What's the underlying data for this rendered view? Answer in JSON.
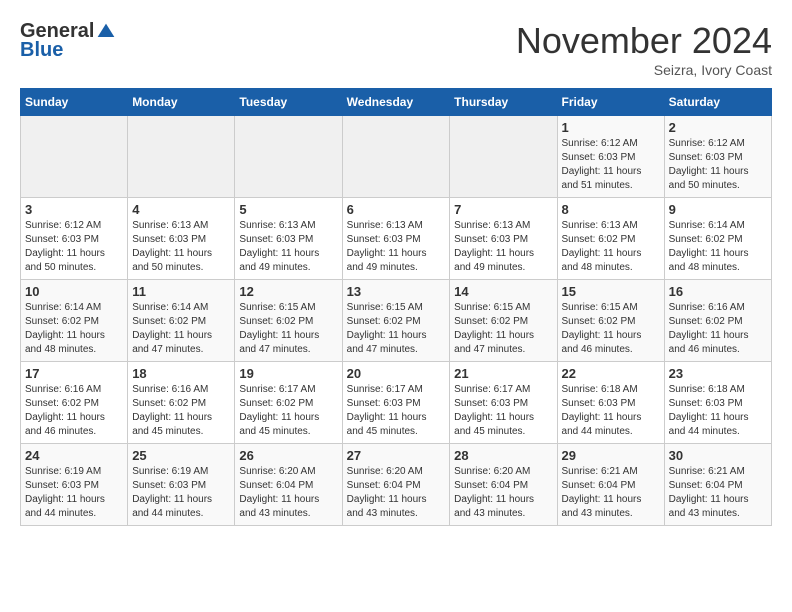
{
  "logo": {
    "general": "General",
    "blue": "Blue"
  },
  "header": {
    "month_title": "November 2024",
    "subtitle": "Seizra, Ivory Coast"
  },
  "days_of_week": [
    "Sunday",
    "Monday",
    "Tuesday",
    "Wednesday",
    "Thursday",
    "Friday",
    "Saturday"
  ],
  "weeks": [
    [
      {
        "day": "",
        "info": ""
      },
      {
        "day": "",
        "info": ""
      },
      {
        "day": "",
        "info": ""
      },
      {
        "day": "",
        "info": ""
      },
      {
        "day": "",
        "info": ""
      },
      {
        "day": "1",
        "info": "Sunrise: 6:12 AM\nSunset: 6:03 PM\nDaylight: 11 hours and 51 minutes."
      },
      {
        "day": "2",
        "info": "Sunrise: 6:12 AM\nSunset: 6:03 PM\nDaylight: 11 hours and 50 minutes."
      }
    ],
    [
      {
        "day": "3",
        "info": "Sunrise: 6:12 AM\nSunset: 6:03 PM\nDaylight: 11 hours and 50 minutes."
      },
      {
        "day": "4",
        "info": "Sunrise: 6:13 AM\nSunset: 6:03 PM\nDaylight: 11 hours and 50 minutes."
      },
      {
        "day": "5",
        "info": "Sunrise: 6:13 AM\nSunset: 6:03 PM\nDaylight: 11 hours and 49 minutes."
      },
      {
        "day": "6",
        "info": "Sunrise: 6:13 AM\nSunset: 6:03 PM\nDaylight: 11 hours and 49 minutes."
      },
      {
        "day": "7",
        "info": "Sunrise: 6:13 AM\nSunset: 6:03 PM\nDaylight: 11 hours and 49 minutes."
      },
      {
        "day": "8",
        "info": "Sunrise: 6:13 AM\nSunset: 6:02 PM\nDaylight: 11 hours and 48 minutes."
      },
      {
        "day": "9",
        "info": "Sunrise: 6:14 AM\nSunset: 6:02 PM\nDaylight: 11 hours and 48 minutes."
      }
    ],
    [
      {
        "day": "10",
        "info": "Sunrise: 6:14 AM\nSunset: 6:02 PM\nDaylight: 11 hours and 48 minutes."
      },
      {
        "day": "11",
        "info": "Sunrise: 6:14 AM\nSunset: 6:02 PM\nDaylight: 11 hours and 47 minutes."
      },
      {
        "day": "12",
        "info": "Sunrise: 6:15 AM\nSunset: 6:02 PM\nDaylight: 11 hours and 47 minutes."
      },
      {
        "day": "13",
        "info": "Sunrise: 6:15 AM\nSunset: 6:02 PM\nDaylight: 11 hours and 47 minutes."
      },
      {
        "day": "14",
        "info": "Sunrise: 6:15 AM\nSunset: 6:02 PM\nDaylight: 11 hours and 47 minutes."
      },
      {
        "day": "15",
        "info": "Sunrise: 6:15 AM\nSunset: 6:02 PM\nDaylight: 11 hours and 46 minutes."
      },
      {
        "day": "16",
        "info": "Sunrise: 6:16 AM\nSunset: 6:02 PM\nDaylight: 11 hours and 46 minutes."
      }
    ],
    [
      {
        "day": "17",
        "info": "Sunrise: 6:16 AM\nSunset: 6:02 PM\nDaylight: 11 hours and 46 minutes."
      },
      {
        "day": "18",
        "info": "Sunrise: 6:16 AM\nSunset: 6:02 PM\nDaylight: 11 hours and 45 minutes."
      },
      {
        "day": "19",
        "info": "Sunrise: 6:17 AM\nSunset: 6:02 PM\nDaylight: 11 hours and 45 minutes."
      },
      {
        "day": "20",
        "info": "Sunrise: 6:17 AM\nSunset: 6:03 PM\nDaylight: 11 hours and 45 minutes."
      },
      {
        "day": "21",
        "info": "Sunrise: 6:17 AM\nSunset: 6:03 PM\nDaylight: 11 hours and 45 minutes."
      },
      {
        "day": "22",
        "info": "Sunrise: 6:18 AM\nSunset: 6:03 PM\nDaylight: 11 hours and 44 minutes."
      },
      {
        "day": "23",
        "info": "Sunrise: 6:18 AM\nSunset: 6:03 PM\nDaylight: 11 hours and 44 minutes."
      }
    ],
    [
      {
        "day": "24",
        "info": "Sunrise: 6:19 AM\nSunset: 6:03 PM\nDaylight: 11 hours and 44 minutes."
      },
      {
        "day": "25",
        "info": "Sunrise: 6:19 AM\nSunset: 6:03 PM\nDaylight: 11 hours and 44 minutes."
      },
      {
        "day": "26",
        "info": "Sunrise: 6:20 AM\nSunset: 6:04 PM\nDaylight: 11 hours and 43 minutes."
      },
      {
        "day": "27",
        "info": "Sunrise: 6:20 AM\nSunset: 6:04 PM\nDaylight: 11 hours and 43 minutes."
      },
      {
        "day": "28",
        "info": "Sunrise: 6:20 AM\nSunset: 6:04 PM\nDaylight: 11 hours and 43 minutes."
      },
      {
        "day": "29",
        "info": "Sunrise: 6:21 AM\nSunset: 6:04 PM\nDaylight: 11 hours and 43 minutes."
      },
      {
        "day": "30",
        "info": "Sunrise: 6:21 AM\nSunset: 6:04 PM\nDaylight: 11 hours and 43 minutes."
      }
    ]
  ]
}
